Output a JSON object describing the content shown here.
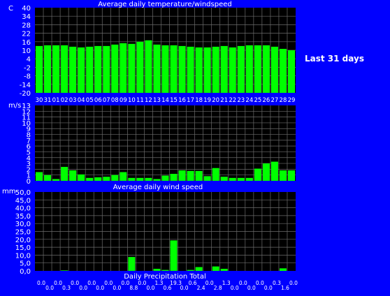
{
  "side_label": "Last 31 days",
  "colors": {
    "background": "#0000ff",
    "plot": "#000000",
    "bar": "#00ff00",
    "text": "#ffffff"
  },
  "chart_data": [
    {
      "type": "bar",
      "title": "Average daily temperature/windspeed",
      "unit": "C",
      "ylim": [
        -20,
        40
      ],
      "yticks": [
        "40",
        "34",
        "28",
        "22",
        "16",
        "10",
        "4",
        "-2",
        "-8",
        "-14",
        "-20"
      ],
      "categories": [
        "30",
        "31",
        "01",
        "02",
        "03",
        "04",
        "05",
        "06",
        "07",
        "08",
        "09",
        "10",
        "11",
        "12",
        "13",
        "14",
        "15",
        "16",
        "17",
        "18",
        "19",
        "20",
        "21",
        "22",
        "23",
        "24",
        "25",
        "26",
        "27",
        "28",
        "29"
      ],
      "values": [
        13,
        13.5,
        13.5,
        13.5,
        12.5,
        12,
        12.5,
        13,
        13,
        14,
        15,
        14.5,
        16,
        17,
        14,
        13.5,
        13.5,
        13,
        12.5,
        12,
        12,
        12.5,
        13,
        12,
        13,
        13.5,
        13.5,
        13.5,
        12.5,
        11,
        10
      ],
      "grid": true
    },
    {
      "type": "bar",
      "title": "Average daily wind speed",
      "unit": "m/s",
      "ylim": [
        0,
        13
      ],
      "yticks": [
        "13",
        "12",
        "11",
        "10",
        "9",
        "8",
        "7",
        "6",
        "5",
        "4",
        "3",
        "2",
        "1",
        "0"
      ],
      "values": [
        1.5,
        1,
        0.3,
        2.4,
        1.8,
        1.1,
        0.5,
        0.6,
        0.7,
        1,
        1.5,
        0.5,
        0.5,
        0.5,
        0.3,
        0.9,
        1.2,
        1.8,
        1.7,
        1.7,
        0.8,
        2.2,
        0.7,
        0.5,
        0.5,
        0.5,
        2.1,
        3,
        3.3,
        1.8,
        1.8
      ],
      "grid": true
    },
    {
      "type": "bar",
      "title": "Daily Precipitation Total",
      "unit": "mm",
      "ylim": [
        0,
        50
      ],
      "yticks": [
        "50,0",
        "45,0",
        "40,0",
        "35,0",
        "30,0",
        "25,0",
        "20,0",
        "15,0",
        "10,0",
        "5,0",
        "0,0"
      ],
      "values": [
        0,
        0,
        0,
        0.3,
        0,
        0,
        0,
        0,
        0,
        0,
        0,
        8.8,
        0,
        0,
        1.3,
        0.6,
        19.3,
        0,
        0.6,
        2.4,
        0,
        2.8,
        1.3,
        0,
        0,
        0,
        0,
        0,
        0,
        1.6,
        0
      ],
      "value_labels": [
        "0.0",
        "0.0",
        "0.0",
        "0.3",
        "0.0",
        "0.0",
        "0.0",
        "0.0",
        "0.0",
        "0.0",
        "0.0",
        "8.8",
        "0.0",
        "0.0",
        "1.3",
        "0.6",
        "19.3",
        "0.0",
        "0.6",
        "2.4",
        "0.0",
        "2.8",
        "1.3",
        "0.0",
        "0.0",
        "0.0",
        "0.0",
        "0.0",
        "0.3",
        "1.6",
        "0.0"
      ],
      "grid": true
    }
  ]
}
